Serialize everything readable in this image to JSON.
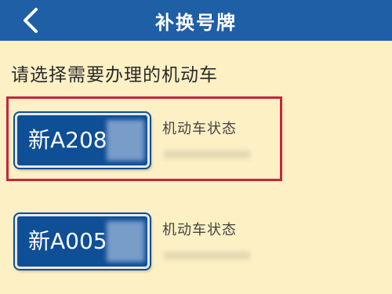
{
  "header": {
    "title": "补换号牌",
    "back_icon": "chevron-left-icon"
  },
  "prompt": "请选择需要办理的机动车",
  "colors": {
    "header_bg": "#1f5fa6",
    "page_bg": "#fcf0c4",
    "plate_bg": "#0f4f96",
    "selected_border": "#c8243a"
  },
  "vehicles": [
    {
      "plate": "新A208",
      "status_label": "机动车状态",
      "selected": true
    },
    {
      "plate": "新A005",
      "status_label": "机动车状态",
      "selected": false
    }
  ]
}
